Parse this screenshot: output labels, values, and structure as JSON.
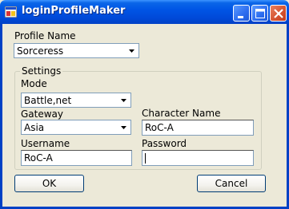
{
  "window": {
    "title": "loginProfileMaker"
  },
  "profile": {
    "label": "Profile Name",
    "value": "Sorceress"
  },
  "settings": {
    "legend": "Settings",
    "mode_label": "Mode",
    "mode_value": "Battle,net",
    "gateway_label": "Gateway",
    "gateway_value": "Asia",
    "character_label": "Character Name",
    "character_value": "RoC-A",
    "username_label": "Username",
    "username_value": "RoC-A",
    "password_label": "Password",
    "password_value": ""
  },
  "buttons": {
    "ok": "OK",
    "cancel": "Cancel"
  },
  "colors": {
    "titlebar": "#0055e5",
    "dialog_bg": "#ece9d8",
    "close_button": "#d4512e"
  }
}
